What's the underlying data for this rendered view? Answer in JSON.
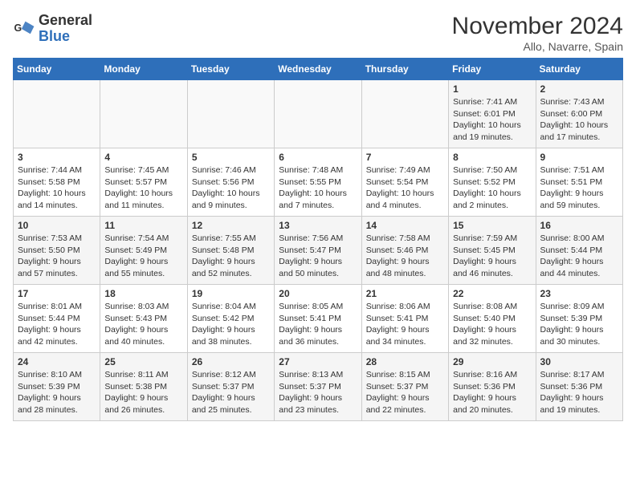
{
  "logo": {
    "text_general": "General",
    "text_blue": "Blue"
  },
  "header": {
    "month_title": "November 2024",
    "location": "Allo, Navarre, Spain"
  },
  "weekdays": [
    "Sunday",
    "Monday",
    "Tuesday",
    "Wednesday",
    "Thursday",
    "Friday",
    "Saturday"
  ],
  "weeks": [
    [
      {
        "day": "",
        "info": ""
      },
      {
        "day": "",
        "info": ""
      },
      {
        "day": "",
        "info": ""
      },
      {
        "day": "",
        "info": ""
      },
      {
        "day": "",
        "info": ""
      },
      {
        "day": "1",
        "info": "Sunrise: 7:41 AM\nSunset: 6:01 PM\nDaylight: 10 hours and 19 minutes."
      },
      {
        "day": "2",
        "info": "Sunrise: 7:43 AM\nSunset: 6:00 PM\nDaylight: 10 hours and 17 minutes."
      }
    ],
    [
      {
        "day": "3",
        "info": "Sunrise: 7:44 AM\nSunset: 5:58 PM\nDaylight: 10 hours and 14 minutes."
      },
      {
        "day": "4",
        "info": "Sunrise: 7:45 AM\nSunset: 5:57 PM\nDaylight: 10 hours and 11 minutes."
      },
      {
        "day": "5",
        "info": "Sunrise: 7:46 AM\nSunset: 5:56 PM\nDaylight: 10 hours and 9 minutes."
      },
      {
        "day": "6",
        "info": "Sunrise: 7:48 AM\nSunset: 5:55 PM\nDaylight: 10 hours and 7 minutes."
      },
      {
        "day": "7",
        "info": "Sunrise: 7:49 AM\nSunset: 5:54 PM\nDaylight: 10 hours and 4 minutes."
      },
      {
        "day": "8",
        "info": "Sunrise: 7:50 AM\nSunset: 5:52 PM\nDaylight: 10 hours and 2 minutes."
      },
      {
        "day": "9",
        "info": "Sunrise: 7:51 AM\nSunset: 5:51 PM\nDaylight: 9 hours and 59 minutes."
      }
    ],
    [
      {
        "day": "10",
        "info": "Sunrise: 7:53 AM\nSunset: 5:50 PM\nDaylight: 9 hours and 57 minutes."
      },
      {
        "day": "11",
        "info": "Sunrise: 7:54 AM\nSunset: 5:49 PM\nDaylight: 9 hours and 55 minutes."
      },
      {
        "day": "12",
        "info": "Sunrise: 7:55 AM\nSunset: 5:48 PM\nDaylight: 9 hours and 52 minutes."
      },
      {
        "day": "13",
        "info": "Sunrise: 7:56 AM\nSunset: 5:47 PM\nDaylight: 9 hours and 50 minutes."
      },
      {
        "day": "14",
        "info": "Sunrise: 7:58 AM\nSunset: 5:46 PM\nDaylight: 9 hours and 48 minutes."
      },
      {
        "day": "15",
        "info": "Sunrise: 7:59 AM\nSunset: 5:45 PM\nDaylight: 9 hours and 46 minutes."
      },
      {
        "day": "16",
        "info": "Sunrise: 8:00 AM\nSunset: 5:44 PM\nDaylight: 9 hours and 44 minutes."
      }
    ],
    [
      {
        "day": "17",
        "info": "Sunrise: 8:01 AM\nSunset: 5:44 PM\nDaylight: 9 hours and 42 minutes."
      },
      {
        "day": "18",
        "info": "Sunrise: 8:03 AM\nSunset: 5:43 PM\nDaylight: 9 hours and 40 minutes."
      },
      {
        "day": "19",
        "info": "Sunrise: 8:04 AM\nSunset: 5:42 PM\nDaylight: 9 hours and 38 minutes."
      },
      {
        "day": "20",
        "info": "Sunrise: 8:05 AM\nSunset: 5:41 PM\nDaylight: 9 hours and 36 minutes."
      },
      {
        "day": "21",
        "info": "Sunrise: 8:06 AM\nSunset: 5:41 PM\nDaylight: 9 hours and 34 minutes."
      },
      {
        "day": "22",
        "info": "Sunrise: 8:08 AM\nSunset: 5:40 PM\nDaylight: 9 hours and 32 minutes."
      },
      {
        "day": "23",
        "info": "Sunrise: 8:09 AM\nSunset: 5:39 PM\nDaylight: 9 hours and 30 minutes."
      }
    ],
    [
      {
        "day": "24",
        "info": "Sunrise: 8:10 AM\nSunset: 5:39 PM\nDaylight: 9 hours and 28 minutes."
      },
      {
        "day": "25",
        "info": "Sunrise: 8:11 AM\nSunset: 5:38 PM\nDaylight: 9 hours and 26 minutes."
      },
      {
        "day": "26",
        "info": "Sunrise: 8:12 AM\nSunset: 5:37 PM\nDaylight: 9 hours and 25 minutes."
      },
      {
        "day": "27",
        "info": "Sunrise: 8:13 AM\nSunset: 5:37 PM\nDaylight: 9 hours and 23 minutes."
      },
      {
        "day": "28",
        "info": "Sunrise: 8:15 AM\nSunset: 5:37 PM\nDaylight: 9 hours and 22 minutes."
      },
      {
        "day": "29",
        "info": "Sunrise: 8:16 AM\nSunset: 5:36 PM\nDaylight: 9 hours and 20 minutes."
      },
      {
        "day": "30",
        "info": "Sunrise: 8:17 AM\nSunset: 5:36 PM\nDaylight: 9 hours and 19 minutes."
      }
    ]
  ]
}
